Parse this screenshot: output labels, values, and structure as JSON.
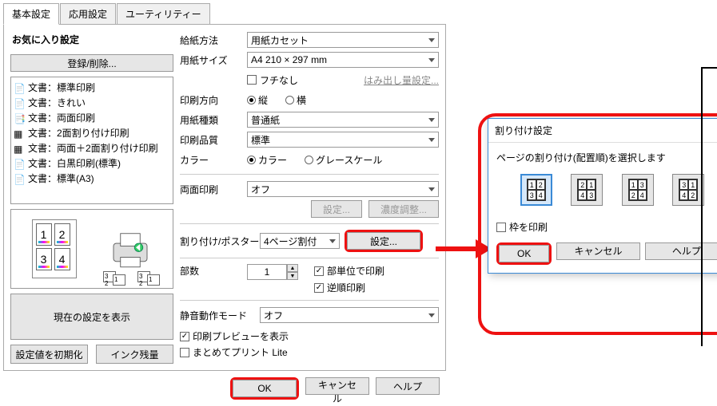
{
  "tabs": [
    "基本設定",
    "応用設定",
    "ユーティリティー"
  ],
  "presets": {
    "title": "お気に入り設定",
    "register_label": "登録/削除...",
    "items": [
      "文書：標準印刷",
      "文書：きれい",
      "文書：両面印刷",
      "文書：2面割り付け印刷",
      "文書：両面＋2面割り付け印刷",
      "文書：白黒印刷(標準)",
      "文書：標準(A3)"
    ],
    "show_current_label": "現在の設定を表示",
    "reset_label": "設定値を初期化",
    "ink_label": "インク残量"
  },
  "settings": {
    "paper_source": {
      "label": "給紙方法",
      "value": "用紙カセット"
    },
    "paper_size": {
      "label": "用紙サイズ",
      "value": "A4 210 × 297 mm"
    },
    "borderless": {
      "label": "フチなし",
      "checked": false,
      "bleed_label": "はみ出し量設定..."
    },
    "orientation": {
      "label": "印刷方向",
      "portrait": "縦",
      "landscape": "横",
      "value": "portrait"
    },
    "paper_type": {
      "label": "用紙種類",
      "value": "普通紙"
    },
    "quality": {
      "label": "印刷品質",
      "value": "標準"
    },
    "color": {
      "label": "カラー",
      "color": "カラー",
      "gray": "グレースケール",
      "value": "color"
    },
    "duplex": {
      "label": "両面印刷",
      "value": "オフ",
      "settings_btn": "設定...",
      "density_btn": "濃度調整..."
    },
    "layout": {
      "label": "割り付け/ポスター",
      "value": "4ページ割付",
      "settings_btn": "設定..."
    },
    "copies": {
      "label": "部数",
      "value": "1",
      "collate": {
        "label": "部単位で印刷",
        "checked": true
      },
      "reverse": {
        "label": "逆順印刷",
        "checked": true
      }
    },
    "quiet": {
      "label": "静音動作モード",
      "value": "オフ"
    },
    "preview": {
      "label": "印刷プレビューを表示",
      "checked": true
    },
    "matomete": {
      "label": "まとめてプリント Lite",
      "checked": false
    }
  },
  "buttons": {
    "ok": "OK",
    "cancel": "キャンセル",
    "help": "ヘルプ"
  },
  "layout_dialog": {
    "title": "割り付け設定",
    "message": "ページの割り付け(配置順)を選択します",
    "options": [
      [
        "1",
        "2",
        "3",
        "4"
      ],
      [
        "2",
        "1",
        "4",
        "3"
      ],
      [
        "1",
        "3",
        "2",
        "4"
      ],
      [
        "3",
        "1",
        "4",
        "2"
      ]
    ],
    "frame_check": {
      "label": "枠を印刷",
      "checked": false
    },
    "ok": "OK",
    "cancel": "キャンセル",
    "help": "ヘルプ"
  }
}
